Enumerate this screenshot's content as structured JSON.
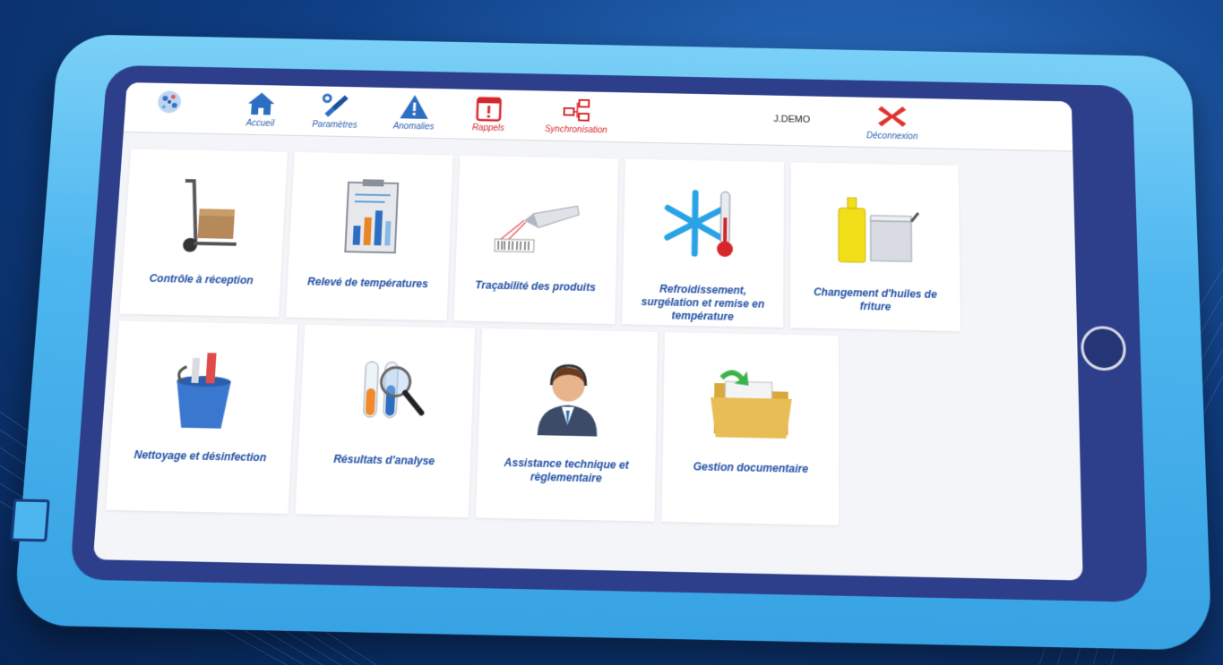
{
  "nav": {
    "items": [
      {
        "label": "Accueil",
        "icon": "home-icon"
      },
      {
        "label": "Paramètres",
        "icon": "tools-icon"
      },
      {
        "label": "Anomalies",
        "icon": "warning-icon"
      },
      {
        "label": "Rappels",
        "icon": "calendar-alert-icon"
      },
      {
        "label": "Synchronisation",
        "icon": "sync-icon"
      }
    ],
    "user": "J.DEMO",
    "logout_label": "Déconnexion"
  },
  "tiles": [
    {
      "label": "Contrôle à réception",
      "icon": "hand-truck-icon"
    },
    {
      "label": "Relevé de températures",
      "icon": "clipboard-chart-icon"
    },
    {
      "label": "Traçabilité des produits",
      "icon": "barcode-scanner-icon"
    },
    {
      "label": "Refroidissement, surgélation et remise en température",
      "icon": "snowflake-thermometer-icon"
    },
    {
      "label": "Changement d'huiles de friture",
      "icon": "fryer-oil-icon"
    },
    {
      "label": "Nettoyage et désinfection",
      "icon": "cleaning-bucket-icon"
    },
    {
      "label": "Résultats d'analyse",
      "icon": "test-tubes-magnifier-icon"
    },
    {
      "label": "Assistance technique et règlementaire",
      "icon": "support-agent-icon"
    },
    {
      "label": "Gestion documentaire",
      "icon": "document-folder-icon"
    }
  ],
  "colors": {
    "accent": "#1f4ea3",
    "alert": "#d6262b",
    "case": "#4eb6ef",
    "bezel": "#2d3f8a"
  }
}
